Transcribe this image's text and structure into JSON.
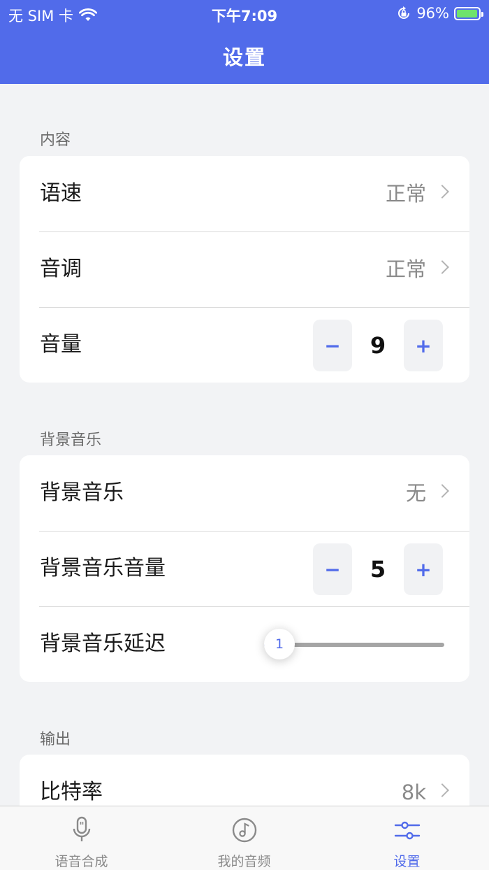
{
  "status_bar": {
    "carrier": "无 SIM 卡",
    "time": "下午7:09",
    "battery_pct": "96%",
    "battery_level": 0.96,
    "icons": [
      "wifi-icon",
      "orientation-lock-icon",
      "battery-charging-icon"
    ]
  },
  "header": {
    "title": "设置"
  },
  "sections": {
    "content": {
      "label": "内容",
      "speed": {
        "label": "语速",
        "value": "正常"
      },
      "pitch": {
        "label": "音调",
        "value": "正常"
      },
      "volume": {
        "label": "音量",
        "value": "9",
        "minus": "−",
        "plus": "+"
      }
    },
    "bgm": {
      "label": "背景音乐",
      "music": {
        "label": "背景音乐",
        "value": "无"
      },
      "volume": {
        "label": "背景音乐音量",
        "value": "5",
        "minus": "−",
        "plus": "+"
      },
      "delay": {
        "label": "背景音乐延迟",
        "value": "1",
        "level": 0.0
      }
    },
    "output": {
      "label": "输出",
      "bitrate": {
        "label": "比特率",
        "value": "8k"
      }
    }
  },
  "tabbar": {
    "tabs": [
      {
        "label": "语音合成",
        "icon": "microphone-icon"
      },
      {
        "label": "我的音频",
        "icon": "music-note-icon"
      },
      {
        "label": "设置",
        "icon": "sliders-icon"
      }
    ],
    "active_index": 2
  },
  "colors": {
    "accent": "#516bea",
    "background": "#f2f3f5",
    "battery_green": "#6fe36b"
  }
}
